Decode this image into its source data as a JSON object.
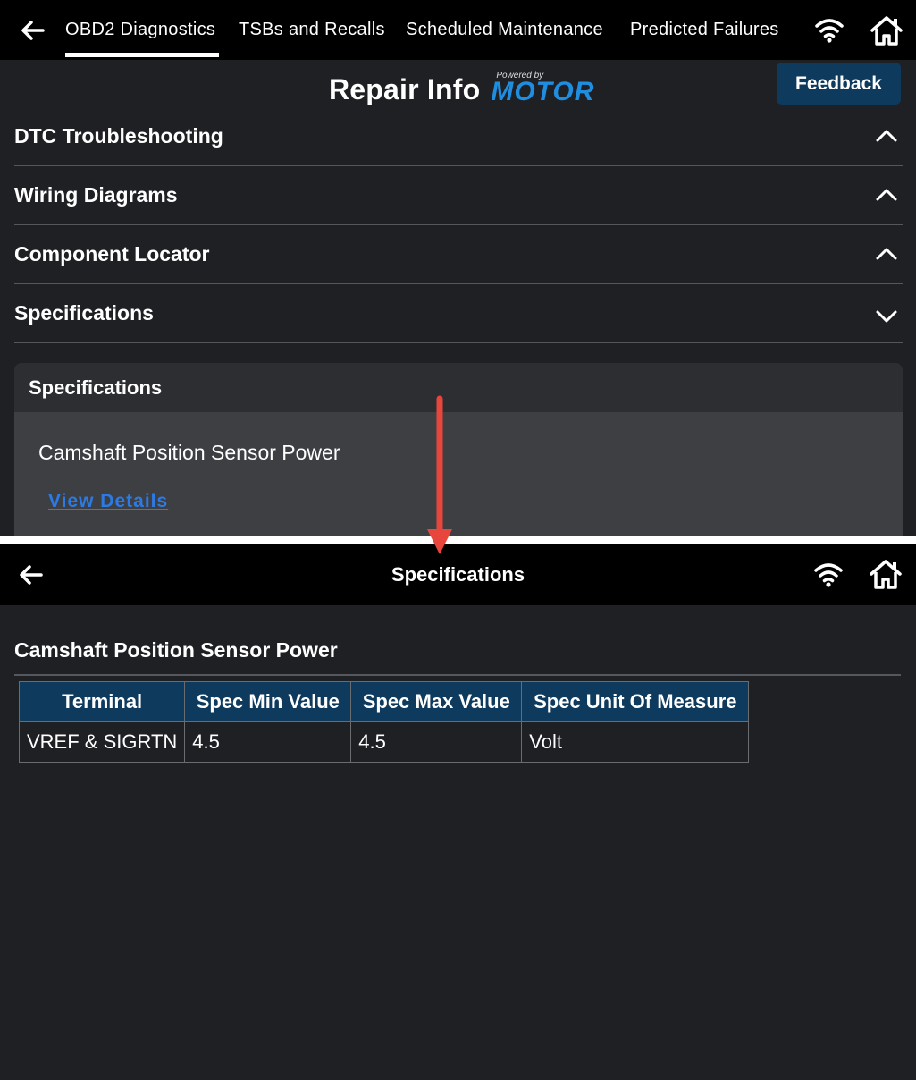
{
  "top_screen": {
    "tabs": [
      {
        "label": "OBD2 Diagnostics",
        "active": true
      },
      {
        "label": "TSBs and Recalls",
        "active": false
      },
      {
        "label": "Scheduled Maintenance",
        "active": false
      },
      {
        "label": "Predicted Failures",
        "active": false
      }
    ],
    "brand": {
      "title": "Repair Info",
      "powered_by": "Powered by",
      "logo_text": "MOTOR"
    },
    "feedback_label": "Feedback",
    "accordion": [
      {
        "label": "DTC Troubleshooting",
        "state": "collapsed",
        "icon": "chevron-up-icon"
      },
      {
        "label": "Wiring Diagrams",
        "state": "collapsed",
        "icon": "chevron-up-icon"
      },
      {
        "label": "Component Locator",
        "state": "collapsed",
        "icon": "chevron-up-icon"
      },
      {
        "label": "Specifications",
        "state": "expanded",
        "icon": "chevron-down-icon"
      }
    ],
    "spec_card": {
      "header": "Specifications",
      "item_title": "Camshaft Position Sensor Power",
      "link_label": "View Details"
    }
  },
  "bottom_screen": {
    "title": "Specifications",
    "detail_title": "Camshaft Position Sensor Power",
    "table": {
      "headers": [
        "Terminal",
        "Spec Min Value",
        "Spec Max Value",
        "Spec Unit Of Measure"
      ],
      "rows": [
        [
          "VREF & SIGRTN",
          "4.5",
          "4.5",
          "Volt"
        ]
      ]
    }
  },
  "colors": {
    "background": "#1f2024",
    "topbar": "#000000",
    "accent_blue": "#0e3a5e",
    "link_blue": "#2c7be5",
    "arrow_red": "#e8453c"
  }
}
